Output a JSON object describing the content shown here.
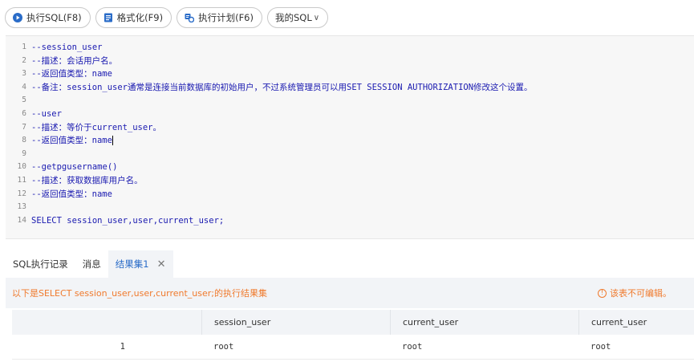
{
  "toolbar": {
    "run_label": "执行SQL(F8)",
    "format_label": "格式化(F9)",
    "plan_label": "执行计划(F6)",
    "mysql_label": "我的SQL",
    "colors": {
      "run_icon": "#2a6cc8",
      "format_icon": "#2a6cc8",
      "plan_icon": "#2a6cc8"
    }
  },
  "editor": {
    "line_numbers": [
      "1",
      "2",
      "3",
      "4",
      "5",
      "6",
      "7",
      "8",
      "9",
      "10",
      "11",
      "12",
      "13",
      "14"
    ],
    "lines": [
      "--session_user",
      "--描述：会话用户名。",
      "--返回值类型：name",
      "--备注：session_user通常是连接当前数据库的初始用户，不过系统管理员可以用SET SESSION AUTHORIZATION修改这个设置。",
      "",
      "--user",
      "--描述：等价于current_user。",
      "--返回值类型：name",
      "",
      "--getpgusername()",
      "--描述：获取数据库用户名。",
      "--返回值类型：name",
      "",
      "SELECT session_user,user,current_user;"
    ]
  },
  "tabs": [
    {
      "label": "SQL执行记录"
    },
    {
      "label": "消息"
    },
    {
      "label": "结果集1"
    }
  ],
  "result": {
    "message": "以下是SELECT session_user,user,current_user;的执行结果集",
    "warning": "该表不可编辑。",
    "columns": [
      "",
      "session_user",
      "current_user",
      "current_user"
    ],
    "rows": [
      [
        "1",
        "root",
        "root",
        "root"
      ]
    ]
  }
}
